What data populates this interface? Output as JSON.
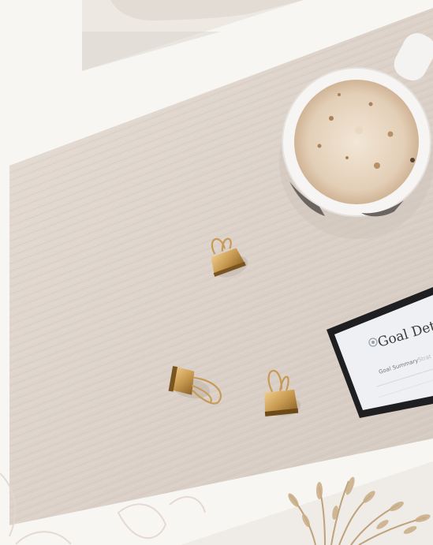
{
  "image": {
    "description": "Flat-lay desk photo: light oak desk with coffee cup, three gold binder clips, and a tablet showing a planner page",
    "colors": {
      "background": "#f8f6f3",
      "desk": "#ddd3cb",
      "coffee": "#e3cfb7",
      "clip_gold": "#c99b52"
    }
  },
  "tablet": {
    "heading": "Goal Detail",
    "tab_active": "Goal Summary",
    "tab_next": "Strat"
  },
  "icons": [
    "coffee-cup",
    "binder-clip",
    "tablet",
    "pampas-grass"
  ]
}
